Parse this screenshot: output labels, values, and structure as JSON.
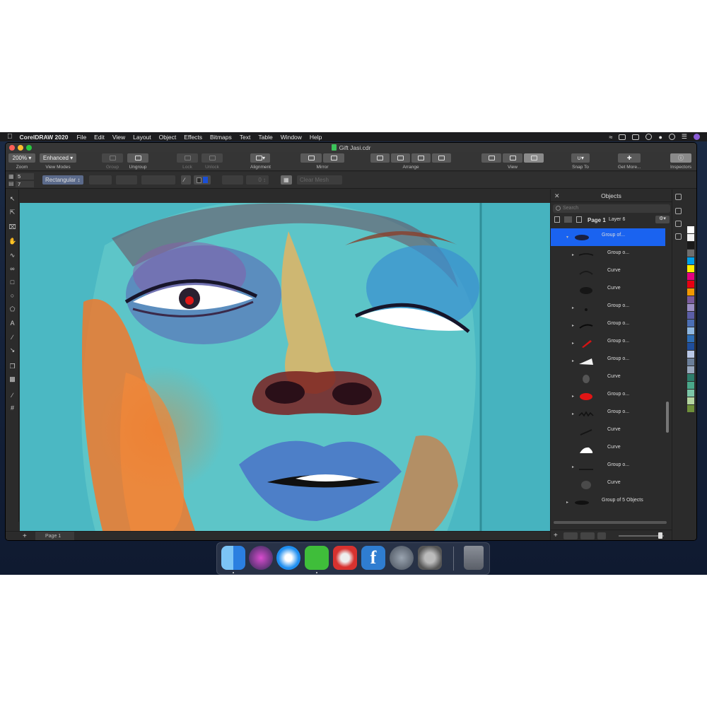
{
  "menubar": {
    "app_name": "CorelDRAW 2020",
    "items": [
      "File",
      "Edit",
      "View",
      "Layout",
      "Object",
      "Effects",
      "Bitmaps",
      "Text",
      "Table",
      "Window",
      "Help"
    ]
  },
  "window": {
    "title": "Gift Jasi.cdr"
  },
  "toolbar": {
    "zoom_value": "200%",
    "zoom_label": "Zoom",
    "viewmode_value": "Enhanced",
    "viewmode_label": "View Modes",
    "group_label": "Group",
    "ungroup_label": "Ungroup",
    "lock_label": "Lock",
    "unlock_label": "Unlock",
    "alignment_label": "Alignment",
    "mirror_label": "Mirror",
    "arrange_label": "Arrange",
    "view_label": "View",
    "snap_label": "Snap To",
    "getmore_label": "Get More...",
    "inspectors_label": "Inspectors"
  },
  "propbar": {
    "rows": "5",
    "cols": "7",
    "mesh_type": "Rectangular",
    "transparency": "0",
    "clear_mesh": "Clear Mesh"
  },
  "pagebar": {
    "page_tab": "Page 1",
    "add": "+"
  },
  "objects_panel": {
    "title": "Objects",
    "search_placeholder": "Search",
    "page": "Page 1",
    "layer": "Layer 6",
    "items": [
      {
        "name": "Group of...",
        "level": 1,
        "selected": true,
        "thumb": "eye-dark"
      },
      {
        "name": "Group o...",
        "level": 2,
        "thumb": "line-dark"
      },
      {
        "name": "Curve",
        "level": 2,
        "thumb": "curve-dark"
      },
      {
        "name": "Curve",
        "level": 2,
        "thumb": "blob-dark"
      },
      {
        "name": "Group o...",
        "level": 2,
        "thumb": "dot-dark"
      },
      {
        "name": "Group o...",
        "level": 2,
        "thumb": "arc-dark"
      },
      {
        "name": "Group o...",
        "level": 2,
        "thumb": "red-slash"
      },
      {
        "name": "Group o...",
        "level": 2,
        "thumb": "white-shape"
      },
      {
        "name": "Curve",
        "level": 2,
        "thumb": "grey-drop"
      },
      {
        "name": "Group o...",
        "level": 2,
        "thumb": "red-blob"
      },
      {
        "name": "Group o...",
        "level": 2,
        "thumb": "lashes-dark"
      },
      {
        "name": "Curve",
        "level": 2,
        "thumb": "dark-stroke"
      },
      {
        "name": "Curve",
        "level": 2,
        "thumb": "white-blob"
      },
      {
        "name": "Group o...",
        "level": 2,
        "thumb": "line-dark"
      },
      {
        "name": "Curve",
        "level": 2,
        "thumb": "grey-blob"
      },
      {
        "name": "Group of 5 Objects",
        "level": 1,
        "thumb": "eye-dark"
      }
    ]
  },
  "palette": {
    "colors": [
      "#ffffff",
      "#f2f2f2",
      "#1a1a1a",
      "#6e6e6e",
      "#00a0e9",
      "#ffef00",
      "#e4007f",
      "#e60012",
      "#f39800",
      "#7a5b9c",
      "#9b8fc4",
      "#5b5ea6",
      "#4b6fb5",
      "#8fb8e2",
      "#2d6db5",
      "#1f4e9c",
      "#b9c8e6",
      "#6b7f99",
      "#9aa9bf",
      "#2e7d6b",
      "#4aa88a",
      "#7cc6a8",
      "#b5d6a0",
      "#6e8f3a"
    ]
  },
  "dock": {
    "apps": [
      "Finder",
      "Siri",
      "Safari",
      "CorelDRAW",
      "Photo Booth",
      "Font",
      "Launchpad",
      "System Preferences",
      "Trash"
    ]
  }
}
